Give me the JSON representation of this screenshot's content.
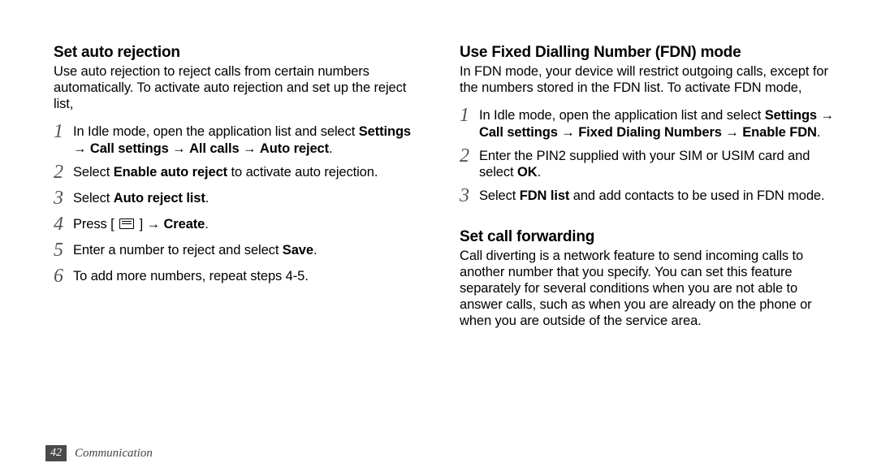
{
  "left": {
    "heading": "Set auto rejection",
    "intro": "Use auto rejection to reject calls from certain numbers automatically. To activate auto rejection and set up the reject list,",
    "steps": [
      {
        "n": "1",
        "html": "In Idle mode, open the application list and select <b>Settings</b> → <b>Call settings</b> → <b>All calls</b> → <b>Auto reject</b>."
      },
      {
        "n": "2",
        "html": "Select <b>Enable auto reject</b> to activate auto rejection."
      },
      {
        "n": "3",
        "html": "Select <b>Auto reject list</b>."
      },
      {
        "n": "4",
        "html": "Press [ {MENU} ] → <b>Create</b>."
      },
      {
        "n": "5",
        "html": "Enter a number to reject and select <b>Save</b>."
      },
      {
        "n": "6",
        "html": "To add more numbers, repeat steps 4-5."
      }
    ]
  },
  "right_a": {
    "heading": "Use Fixed Dialling Number (FDN) mode",
    "intro": "In FDN mode, your device will restrict outgoing calls, except for the numbers stored in the FDN list. To activate FDN mode,",
    "steps": [
      {
        "n": "1",
        "html": "In Idle mode, open the application list and select <b>Settings</b> → <b>Call settings</b> → <b>Fixed Dialing Numbers</b> → <b>Enable FDN</b>."
      },
      {
        "n": "2",
        "html": "Enter the PIN2 supplied with your SIM or USIM card and select <b>OK</b>."
      },
      {
        "n": "3",
        "html": "Select <b>FDN list</b> and add contacts to be used in FDN mode."
      }
    ]
  },
  "right_b": {
    "heading": "Set call forwarding",
    "intro": "Call diverting is a network feature to send incoming calls to another number that you specify. You can set this feature separately for several conditions when you are not able to answer calls, such as when you are already on the phone or when you are outside of the service area."
  },
  "footer": {
    "page": "42",
    "section": "Communication"
  }
}
